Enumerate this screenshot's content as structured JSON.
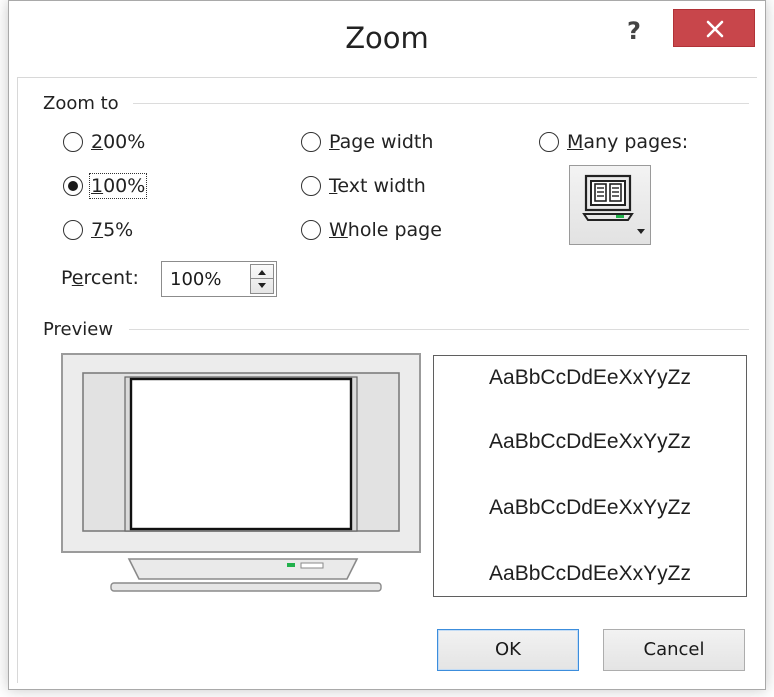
{
  "dialog": {
    "title": "Zoom",
    "help_glyph": "?",
    "close_icon": "close-icon"
  },
  "zoom_to": {
    "label": "Zoom to",
    "options": [
      {
        "id": "200",
        "label": "200%",
        "mnemonic_index": 0,
        "checked": false
      },
      {
        "id": "100",
        "label": "100%",
        "mnemonic_index": 0,
        "checked": true,
        "focused": true
      },
      {
        "id": "75",
        "label": "75%",
        "mnemonic_index": 0,
        "checked": false
      },
      {
        "id": "page-width",
        "label": "Page width",
        "mnemonic_index": 0,
        "checked": false
      },
      {
        "id": "text-width",
        "label": "Text width",
        "mnemonic_index": 0,
        "checked": false
      },
      {
        "id": "whole-page",
        "label": "Whole page",
        "mnemonic_index": 0,
        "checked": false
      },
      {
        "id": "many-pages",
        "label": "Many pages:",
        "mnemonic_index": 0,
        "checked": false
      }
    ],
    "many_pages_button_icon": "monitor-pages-icon",
    "percent": {
      "label": "Percent:",
      "mnemonic_index": 1,
      "value": "100%"
    }
  },
  "preview": {
    "label": "Preview",
    "samples": [
      "AaBbCcDdEeXxYyZz",
      "AaBbCcDdEeXxYyZz",
      "AaBbCcDdEeXxYyZz",
      "AaBbCcDdEeXxYyZz"
    ]
  },
  "buttons": {
    "ok": "OK",
    "cancel": "Cancel"
  },
  "colors": {
    "close_button": "#c8464b",
    "default_button_border": "#3c8ddc",
    "monitor_led": "#22b14c"
  }
}
